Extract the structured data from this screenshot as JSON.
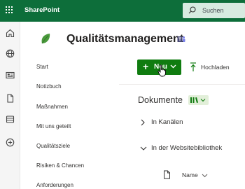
{
  "topbar": {
    "app_name": "SharePoint",
    "search_placeholder": "Suchen",
    "colors": {
      "suite_bar": "#0d6e3a",
      "accent": "#107c10"
    }
  },
  "rail": {
    "icons": [
      "home-icon",
      "globe-icon",
      "news-icon",
      "file-icon",
      "list-icon",
      "add-circle-icon"
    ]
  },
  "site": {
    "title": "Qualitätsmanagement"
  },
  "nav": {
    "items": [
      {
        "label": "Start"
      },
      {
        "label": "Notizbuch"
      },
      {
        "label": "Maßnahmen"
      },
      {
        "label": "Mit uns geteilt"
      },
      {
        "label": "Qualitätsziele"
      },
      {
        "label": "Risiken & Chancen"
      },
      {
        "label": "Anforderungen"
      }
    ]
  },
  "toolbar": {
    "new_label": "Neu",
    "upload_label": "Hochladen"
  },
  "documents": {
    "title": "Dokumente",
    "groups": [
      {
        "label": "In Kanälen",
        "expanded": false
      },
      {
        "label": "In der Websitebibliothek",
        "expanded": true
      }
    ],
    "columns": {
      "name": "Name"
    }
  }
}
